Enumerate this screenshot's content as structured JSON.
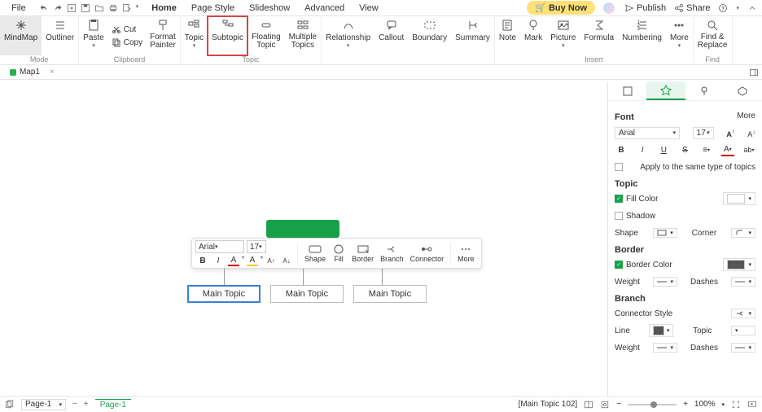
{
  "menu": {
    "file": "File",
    "items": [
      "Home",
      "Page Style",
      "Slideshow",
      "Advanced",
      "View"
    ],
    "active": "Home",
    "buy": "Buy Now",
    "publish": "Publish",
    "share": "Share"
  },
  "ribbon": {
    "mode": {
      "label": "Mode",
      "mindmap": "MindMap",
      "outliner": "Outliner"
    },
    "clipboard": {
      "label": "Clipboard",
      "paste": "Paste",
      "cut": "Cut",
      "copy": "Copy",
      "format_painter": "Format\nPainter"
    },
    "topic": {
      "label": "Topic",
      "topic": "Topic",
      "subtopic": "Subtopic",
      "floating": "Floating\nTopic",
      "multiple": "Multiple\nTopics"
    },
    "relationship": "Relationship",
    "callout": "Callout",
    "boundary": "Boundary",
    "summary": "Summary",
    "insert": {
      "label": "Insert",
      "note": "Note",
      "mark": "Mark",
      "picture": "Picture",
      "formula": "Formula",
      "numbering": "Numbering",
      "more": "More"
    },
    "find": {
      "label": "Find",
      "find_replace": "Find &\nReplace"
    }
  },
  "tabs": {
    "tab1": "Map1"
  },
  "canvas": {
    "topics": [
      "Main Topic",
      "Main Topic",
      "Main Topic"
    ]
  },
  "floatbar": {
    "font": "Arial",
    "size": "17",
    "shape": "Shape",
    "fill": "Fill",
    "border": "Border",
    "branch": "Branch",
    "connector": "Connector",
    "more": "More"
  },
  "side": {
    "font": {
      "heading": "Font",
      "more": "More",
      "name": "Arial",
      "size": "17",
      "increase": "A+",
      "decrease": "A-",
      "apply": "Apply to the same type of topics"
    },
    "topic": {
      "heading": "Topic",
      "fill": "Fill Color",
      "shadow": "Shadow",
      "shape": "Shape",
      "corner": "Corner"
    },
    "border": {
      "heading": "Border",
      "color": "Border Color",
      "weight": "Weight",
      "dashes": "Dashes",
      "swatch": "#555555"
    },
    "branch": {
      "heading": "Branch",
      "connector": "Connector Style",
      "line": "Line",
      "topic": "Topic",
      "weight": "Weight",
      "dashes": "Dashes",
      "swatch": "#555555"
    }
  },
  "status": {
    "page_label": "Page-1",
    "page_tab": "Page-1",
    "hint": "[Main Topic 102]",
    "zoom": "100%"
  }
}
